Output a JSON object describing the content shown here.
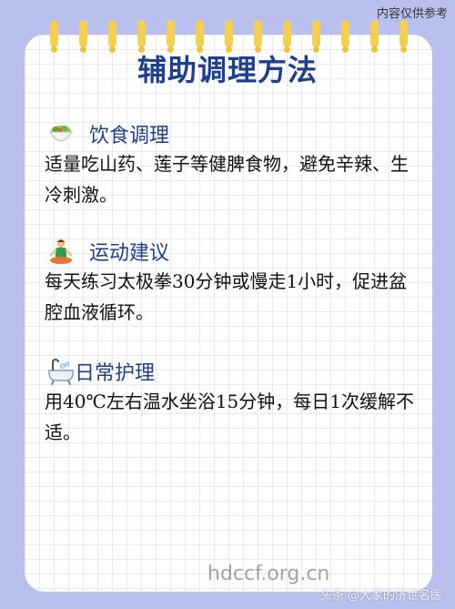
{
  "disclaimer": "内容仅供参考",
  "title": "辅助调理方法",
  "sections": [
    {
      "icon": "salad-bowl-icon",
      "heading": "饮食调理",
      "text": "适量吃山药、莲子等健脾食物，避免辛辣、生冷刺激。"
    },
    {
      "icon": "person-meditating-icon",
      "heading": "运动建议",
      "text": "每天练习太极拳30分钟或慢走1小时，促进盆腔血液循环。"
    },
    {
      "icon": "bathtub-icon",
      "heading": "日常护理",
      "text": "用40℃左右温水坐浴15分钟，每日1次缓解不适。"
    }
  ],
  "watermark": {
    "site": "hdccf.org.cn",
    "account": "头条 @大家的济世名医"
  },
  "colors": {
    "background": "#b9c0ee",
    "accent": "#1f3f8e",
    "ring": "#f4cf52"
  }
}
